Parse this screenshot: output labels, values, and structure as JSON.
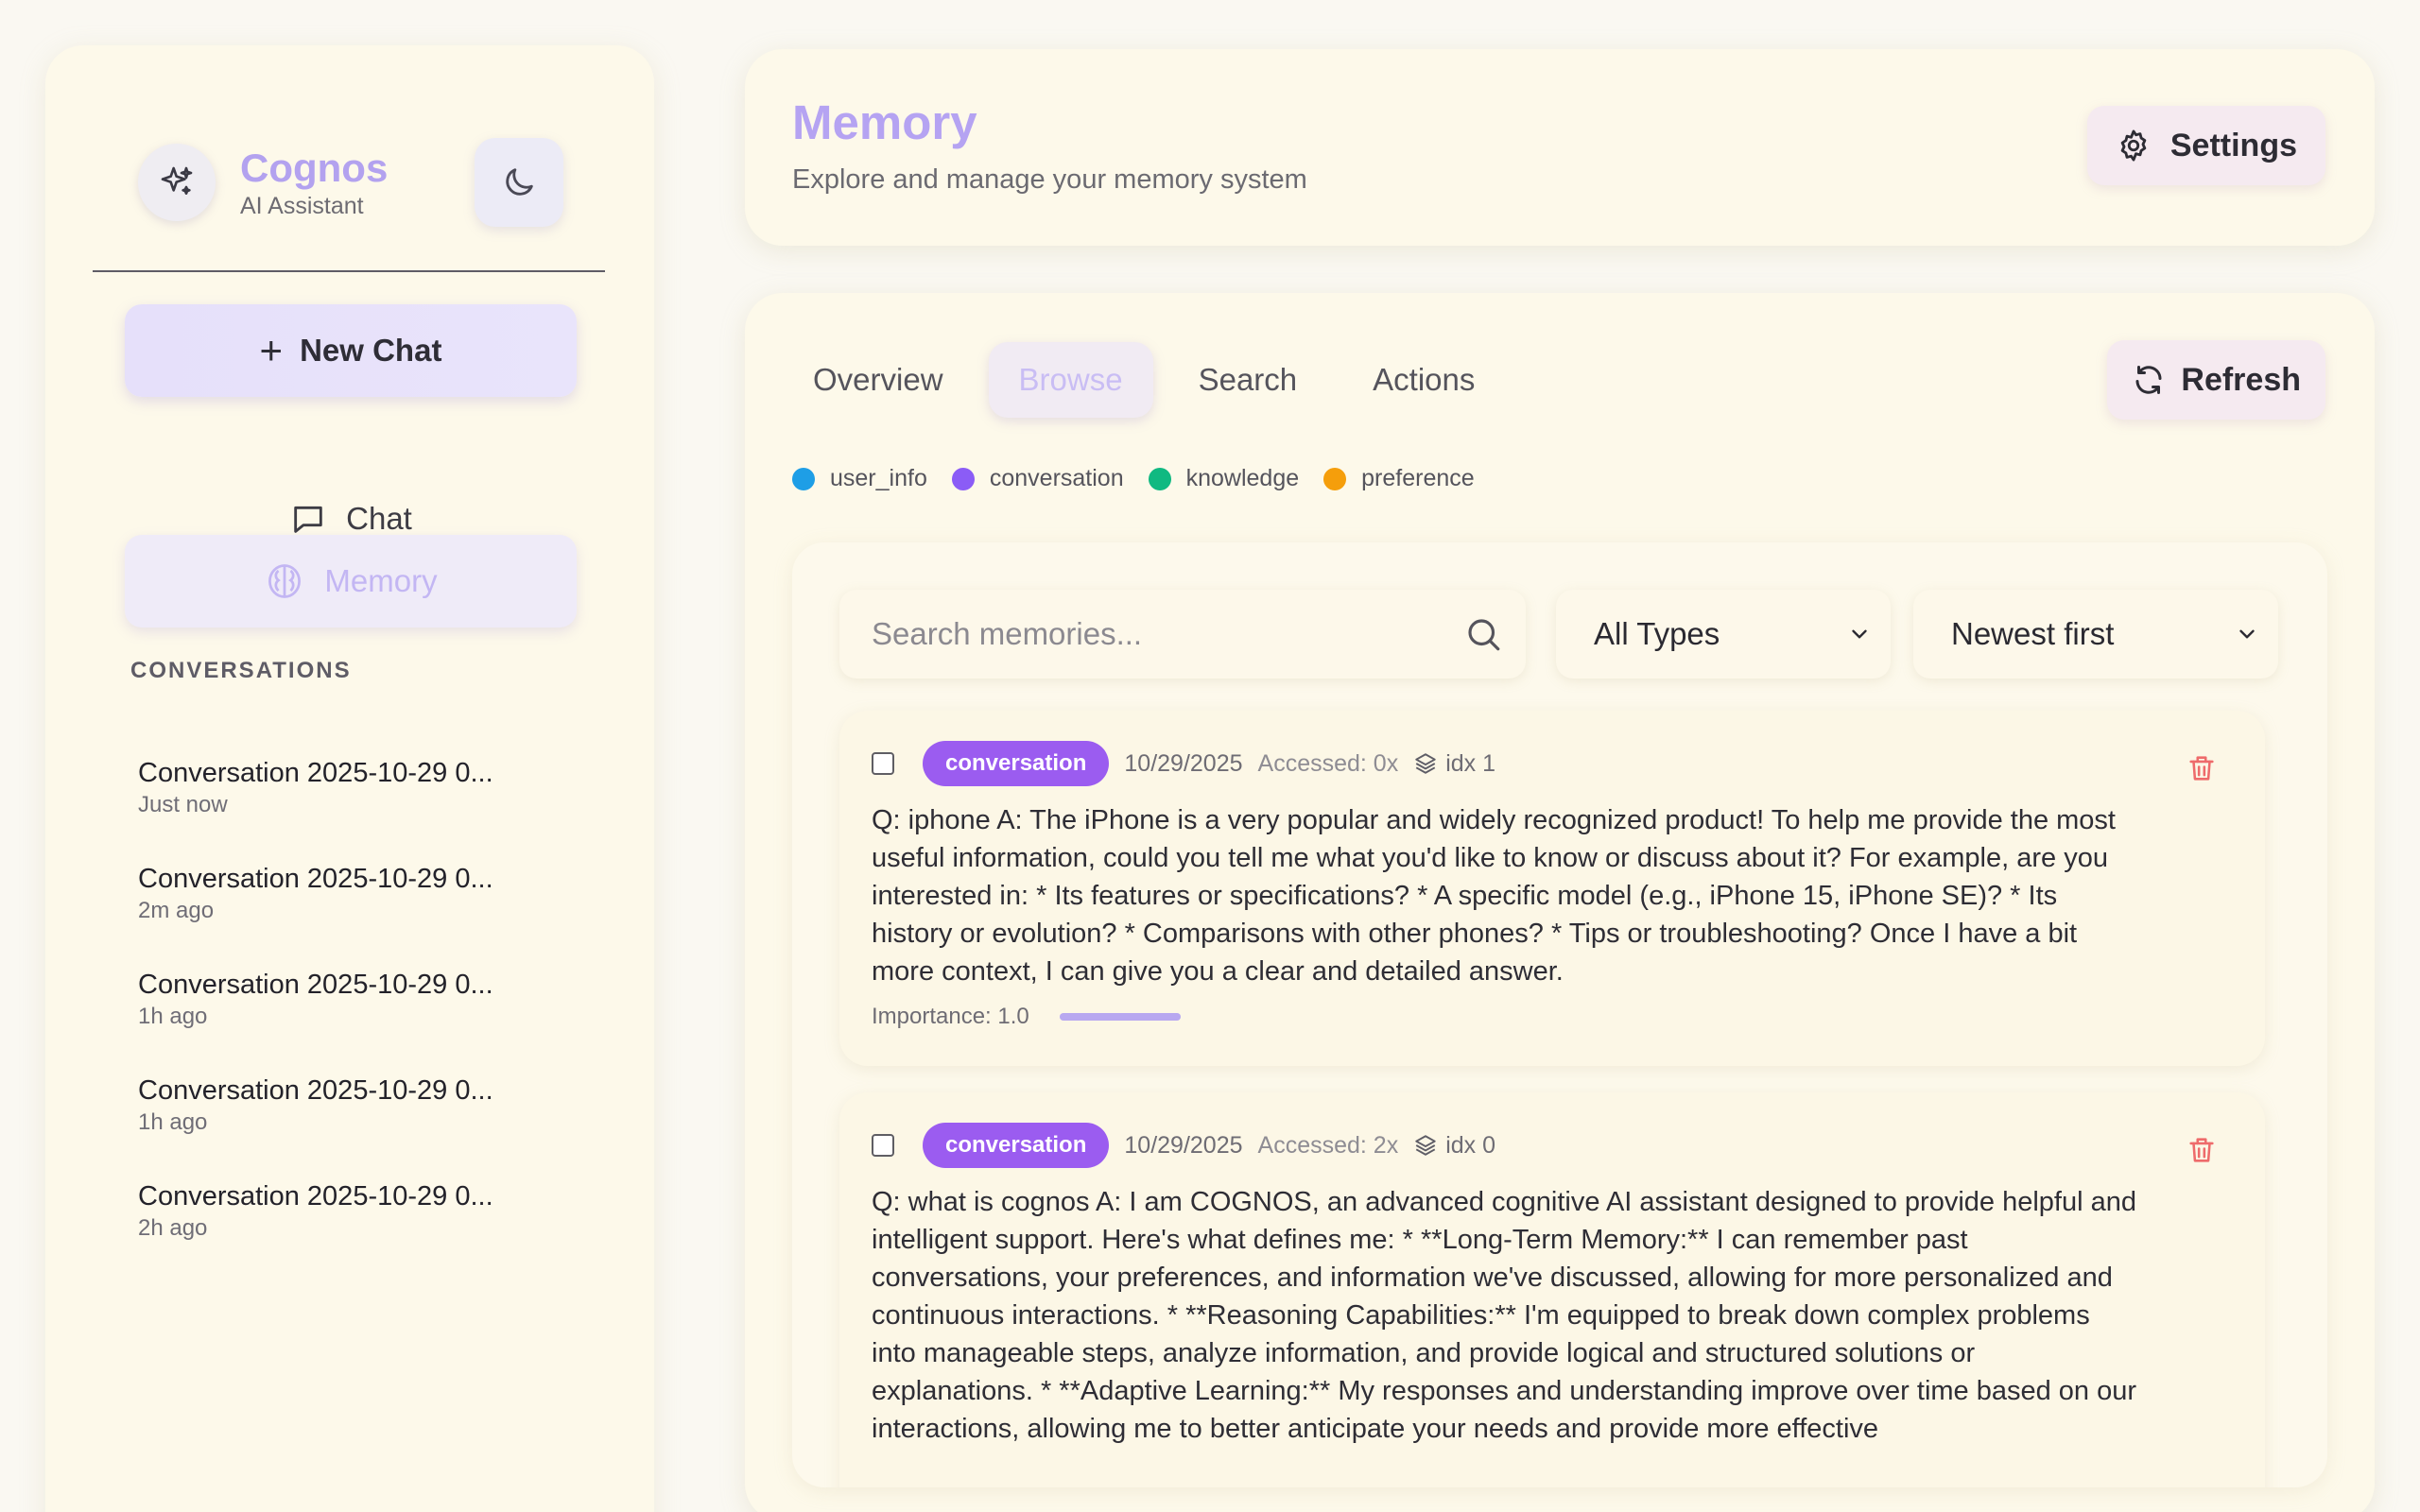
{
  "sidebar": {
    "brand_name": "Cognos",
    "brand_sub": "AI Assistant",
    "new_chat_label": "New Chat",
    "nav": {
      "chat": "Chat",
      "memory": "Memory"
    },
    "conversations_heading": "CONVERSATIONS",
    "conversations": [
      {
        "title": "Conversation 2025-10-29 0...",
        "time": "Just now"
      },
      {
        "title": "Conversation 2025-10-29 0...",
        "time": "2m ago"
      },
      {
        "title": "Conversation 2025-10-29 0...",
        "time": "1h ago"
      },
      {
        "title": "Conversation 2025-10-29 0...",
        "time": "1h ago"
      },
      {
        "title": "Conversation 2025-10-29 0...",
        "time": "2h ago"
      }
    ]
  },
  "header": {
    "title": "Memory",
    "subtitle": "Explore and manage your memory system",
    "settings_label": "Settings"
  },
  "main": {
    "tabs": [
      "Overview",
      "Browse",
      "Search",
      "Actions"
    ],
    "active_tab": "Browse",
    "refresh_label": "Refresh",
    "legend": [
      {
        "label": "user_info",
        "color": "#1e9ee6"
      },
      {
        "label": "conversation",
        "color": "#8b5cf6"
      },
      {
        "label": "knowledge",
        "color": "#10b981"
      },
      {
        "label": "preference",
        "color": "#f59e0b"
      }
    ],
    "search": {
      "placeholder": "Search memories...",
      "value": ""
    },
    "type_filter": "All Types",
    "sort": "Newest first",
    "memories": [
      {
        "type": "conversation",
        "date": "10/29/2025",
        "accessed": "Accessed: 0x",
        "idx": "idx 1",
        "text": "Q: iphone A: The iPhone is a very popular and widely recognized product! To help me provide the most useful information, could you tell me what you'd like to know or discuss about it? For example, are you interested in: * Its features or specifications? * A specific model (e.g., iPhone 15, iPhone SE)? * Its history or evolution? * Comparisons with other phones? * Tips or troubleshooting? Once I have a bit more context, I can give you a clear and detailed answer.",
        "importance_label": "Importance: 1.0",
        "importance": 1.0
      },
      {
        "type": "conversation",
        "date": "10/29/2025",
        "accessed": "Accessed: 2x",
        "idx": "idx 0",
        "text": "Q: what is cognos A: I am COGNOS, an advanced cognitive AI assistant designed to provide helpful and intelligent support. Here's what defines me: * **Long-Term Memory:** I can remember past conversations, your preferences, and information we've discussed, allowing for more personalized and continuous interactions. * **Reasoning Capabilities:** I'm equipped to break down complex problems into manageable steps, analyze information, and provide logical and structured solutions or explanations. * **Adaptive Learning:** My responses and understanding improve over time based on our interactions, allowing me to better anticipate your needs and provide more effective"
      }
    ]
  }
}
